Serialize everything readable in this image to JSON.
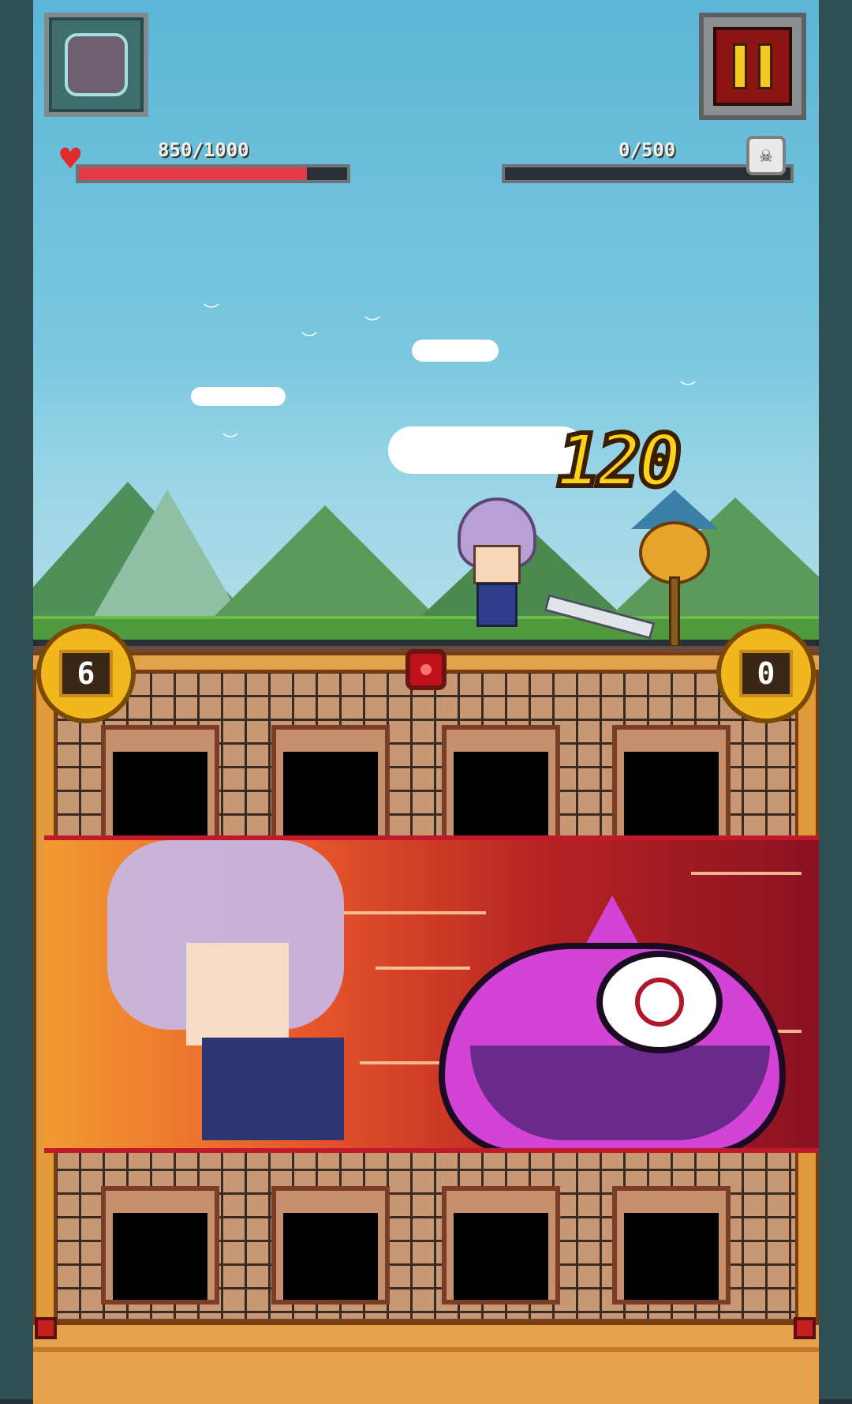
{
  "hud": {
    "player_hp_text": "850/1000",
    "player_hp_fraction": 0.85,
    "enemy_hp_text": "0/500",
    "enemy_hp_fraction": 0.0
  },
  "combat": {
    "damage_number": "120"
  },
  "board": {
    "left_counter": "6",
    "right_counter": "0",
    "top_slots": 4,
    "bottom_slots": 4
  },
  "colors": {
    "hp_fill": "#e23a48",
    "damage_text": "#ffd21a",
    "pause_bg": "#8c1414",
    "slime": "#d243d6"
  },
  "icons": {
    "portrait": "character-portrait-icon",
    "pause": "pause-icon",
    "heart": "heart-icon",
    "skull": "skull-icon",
    "gem": "red-gem-icon"
  }
}
